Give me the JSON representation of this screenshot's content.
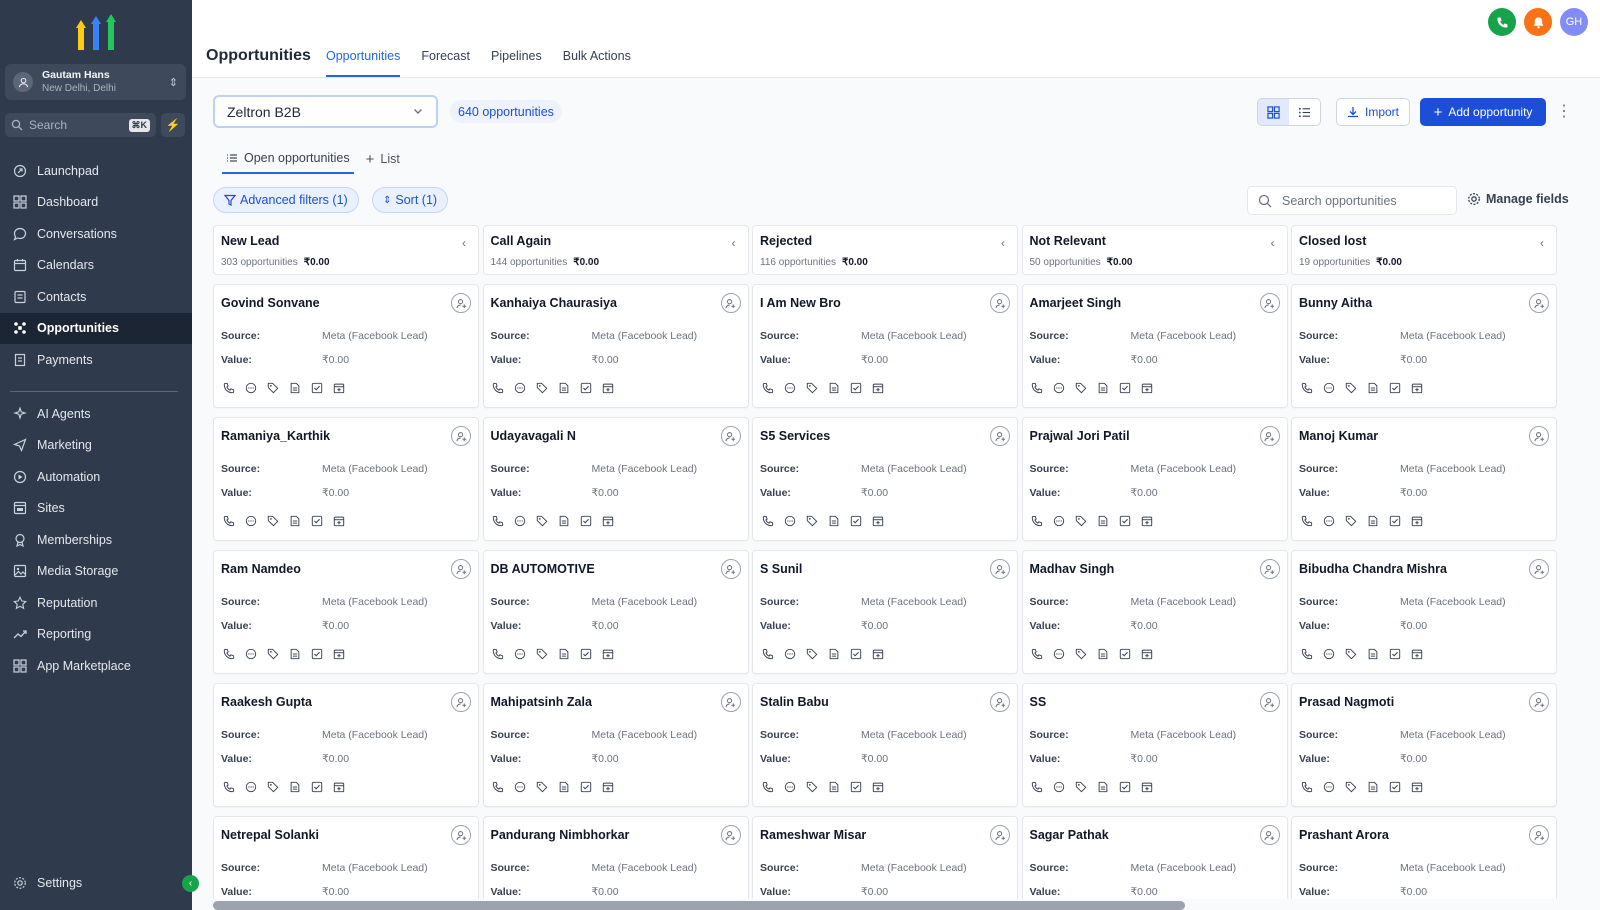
{
  "account": {
    "name": "Gautam Hans",
    "location": "New Delhi, Delhi"
  },
  "search": {
    "placeholder": "Search",
    "shortcut": "⌘K"
  },
  "nav": {
    "primary": [
      {
        "label": "Launchpad",
        "icon": "rocket-icon"
      },
      {
        "label": "Dashboard",
        "icon": "grid-icon"
      },
      {
        "label": "Conversations",
        "icon": "chat-icon"
      },
      {
        "label": "Calendars",
        "icon": "calendar-icon"
      },
      {
        "label": "Contacts",
        "icon": "contacts-icon"
      },
      {
        "label": "Opportunities",
        "icon": "opportunities-icon"
      },
      {
        "label": "Payments",
        "icon": "receipt-icon"
      }
    ],
    "secondary": [
      {
        "label": "AI Agents",
        "icon": "sparkle-icon"
      },
      {
        "label": "Marketing",
        "icon": "send-icon"
      },
      {
        "label": "Automation",
        "icon": "automation-icon"
      },
      {
        "label": "Sites",
        "icon": "sites-icon"
      },
      {
        "label": "Memberships",
        "icon": "membership-icon"
      },
      {
        "label": "Media Storage",
        "icon": "image-icon"
      },
      {
        "label": "Reputation",
        "icon": "star-icon"
      },
      {
        "label": "Reporting",
        "icon": "trend-icon"
      },
      {
        "label": "App Marketplace",
        "icon": "apps-icon"
      }
    ],
    "settings": "Settings",
    "active": "Opportunities"
  },
  "header": {
    "title": "Opportunities",
    "tabs": [
      "Opportunities",
      "Forecast",
      "Pipelines",
      "Bulk Actions"
    ],
    "active_tab": "Opportunities",
    "avatar_initials": "GH"
  },
  "toolbar": {
    "pipeline": "Zeltron B2B",
    "count": "640 opportunities",
    "import_label": "Import",
    "add_label": "Add opportunity"
  },
  "subtabs": {
    "open": "Open opportunities",
    "list": "List"
  },
  "filters": {
    "advanced": "Advanced filters (1)",
    "sort": "Sort (1)",
    "search_placeholder": "Search opportunities",
    "manage_fields": "Manage fields"
  },
  "card_labels": {
    "source": "Source:",
    "value": "Value:"
  },
  "columns": [
    {
      "title": "New Lead",
      "count": "303 opportunities",
      "value": "₹0.00",
      "cards": [
        {
          "name": "Govind Sonvane",
          "source": "Meta (Facebook Lead)",
          "value": "₹0.00"
        },
        {
          "name": "Ramaniya_Karthik",
          "source": "Meta (Facebook Lead)",
          "value": "₹0.00"
        },
        {
          "name": "Ram Namdeo",
          "source": "Meta (Facebook Lead)",
          "value": "₹0.00"
        },
        {
          "name": "Raakesh Gupta",
          "source": "Meta (Facebook Lead)",
          "value": "₹0.00"
        },
        {
          "name": "Netrepal Solanki",
          "source": "Meta (Facebook Lead)",
          "value": "₹0.00"
        }
      ]
    },
    {
      "title": "Call Again",
      "count": "144 opportunities",
      "value": "₹0.00",
      "cards": [
        {
          "name": "Kanhaiya Chaurasiya",
          "source": "Meta (Facebook Lead)",
          "value": "₹0.00"
        },
        {
          "name": "Udayavagali N",
          "source": "Meta (Facebook Lead)",
          "value": "₹0.00"
        },
        {
          "name": "DB AUTOMOTIVE",
          "source": "Meta (Facebook Lead)",
          "value": "₹0.00"
        },
        {
          "name": "Mahipatsinh Zala",
          "source": "Meta (Facebook Lead)",
          "value": "₹0.00"
        },
        {
          "name": "Pandurang Nimbhorkar",
          "source": "Meta (Facebook Lead)",
          "value": "₹0.00"
        }
      ]
    },
    {
      "title": "Rejected",
      "count": "116 opportunities",
      "value": "₹0.00",
      "cards": [
        {
          "name": "I Am New Bro",
          "source": "Meta (Facebook Lead)",
          "value": "₹0.00"
        },
        {
          "name": "S5 Services",
          "source": "Meta (Facebook Lead)",
          "value": "₹0.00"
        },
        {
          "name": "S Sunil",
          "source": "Meta (Facebook Lead)",
          "value": "₹0.00"
        },
        {
          "name": "Stalin Babu",
          "source": "Meta (Facebook Lead)",
          "value": "₹0.00"
        },
        {
          "name": "Rameshwar Misar",
          "source": "Meta (Facebook Lead)",
          "value": "₹0.00"
        }
      ]
    },
    {
      "title": "Not Relevant",
      "count": "50 opportunities",
      "value": "₹0.00",
      "cards": [
        {
          "name": "Amarjeet Singh",
          "source": "Meta (Facebook Lead)",
          "value": "₹0.00"
        },
        {
          "name": "Prajwal Jori Patil",
          "source": "Meta (Facebook Lead)",
          "value": "₹0.00"
        },
        {
          "name": "Madhav Singh",
          "source": "Meta (Facebook Lead)",
          "value": "₹0.00"
        },
        {
          "name": "SS",
          "source": "Meta (Facebook Lead)",
          "value": "₹0.00"
        },
        {
          "name": "Sagar Pathak",
          "source": "Meta (Facebook Lead)",
          "value": "₹0.00"
        }
      ]
    },
    {
      "title": "Closed lost",
      "count": "19 opportunities",
      "value": "₹0.00",
      "cards": [
        {
          "name": "Bunny Aitha",
          "source": "Meta (Facebook Lead)",
          "value": "₹0.00"
        },
        {
          "name": "Manoj Kumar",
          "source": "Meta (Facebook Lead)",
          "value": "₹0.00"
        },
        {
          "name": "Bibudha Chandra Mishra",
          "source": "Meta (Facebook Lead)",
          "value": "₹0.00"
        },
        {
          "name": "Prasad Nagmoti",
          "source": "Meta (Facebook Lead)",
          "value": "₹0.00"
        },
        {
          "name": "Prashant Arora",
          "source": "Meta (Facebook Lead)",
          "value": "₹0.00"
        }
      ]
    }
  ],
  "card_actions": [
    "phone-icon",
    "message-icon",
    "tag-icon",
    "note-icon",
    "task-icon",
    "appointment-icon"
  ],
  "colors": {
    "accent": "#1d4ed8",
    "sidebar": "#2f3b4c",
    "sidebar_active": "#1c2533",
    "phone": "#16a34a",
    "notify": "#f97316",
    "avatar": "#818cf8"
  }
}
